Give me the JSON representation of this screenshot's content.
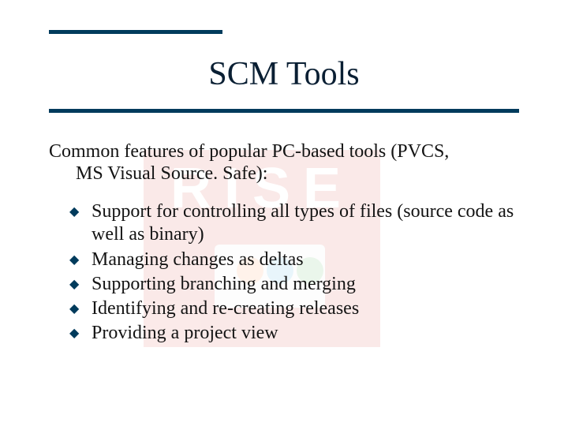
{
  "title": "SCM Tools",
  "intro_line1": "Common features of popular PC-based tools (PVCS,",
  "intro_line2": "MS Visual Source. Safe):",
  "watermark_text": "RISE",
  "bullets": [
    "Support for controlling all types of files (source code as well as binary)",
    "Managing changes as deltas",
    "Supporting branching and merging",
    "Identifying and re-creating releases",
    "Providing a project view"
  ]
}
